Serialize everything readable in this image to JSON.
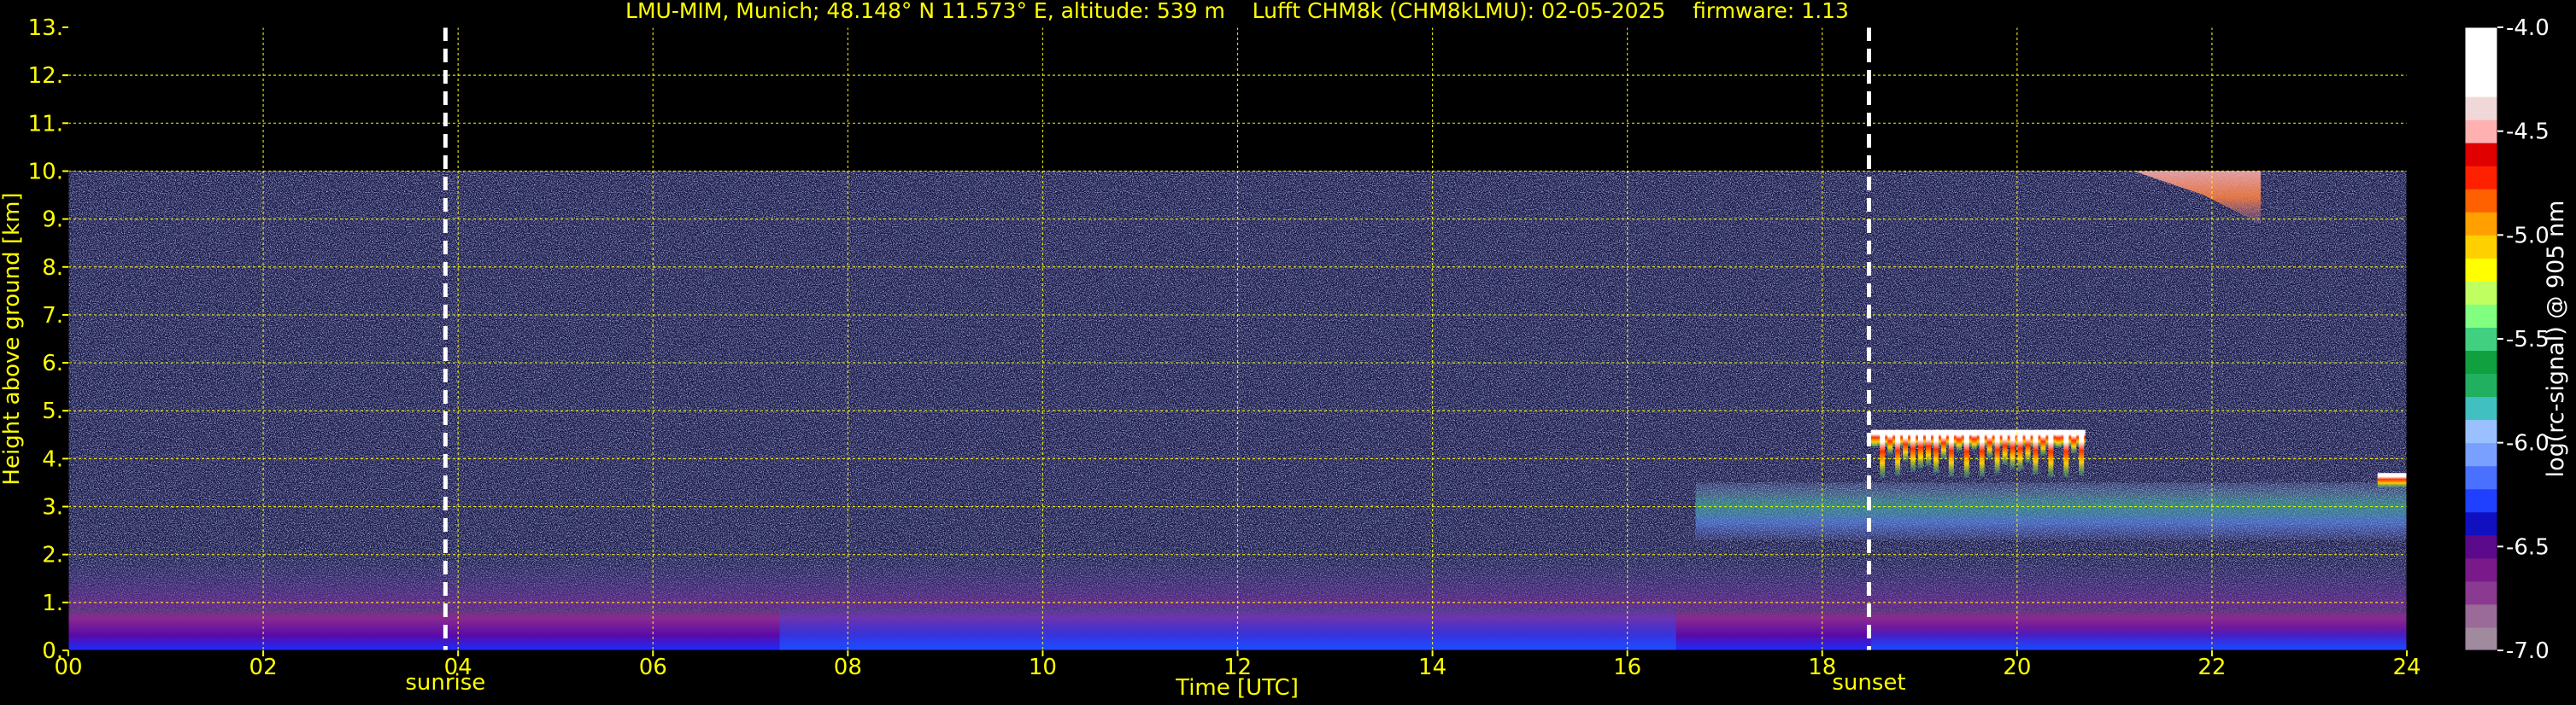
{
  "chart_data": {
    "type": "heatmap",
    "title": "LMU-MIM, Munich; 48.148° N 11.573° E, altitude: 539 m    Lufft CHM8k (CHM8kLMU): 02-05-2025    firmware: 1.13",
    "xlabel": "Time [UTC]",
    "ylabel": "Height above ground [km]",
    "xlim": [
      0,
      24
    ],
    "ylim": [
      0,
      13
    ],
    "x_ticks": [
      0,
      2,
      4,
      6,
      8,
      10,
      12,
      14,
      16,
      18,
      20,
      22,
      24
    ],
    "x_tick_labels": [
      "00",
      "02",
      "04",
      "06",
      "08",
      "10",
      "12",
      "14",
      "16",
      "18",
      "20",
      "22",
      "24"
    ],
    "y_ticks": [
      0,
      1,
      2,
      3,
      4,
      5,
      6,
      7,
      8,
      9,
      10,
      11,
      12,
      13
    ],
    "y_tick_labels": [
      "0.",
      "1.",
      "2.",
      "3.",
      "4.",
      "5.",
      "6.",
      "7.",
      "8.",
      "9.",
      "10.",
      "11.",
      "12.",
      "13."
    ],
    "grid": true,
    "grid_color": "#ffff00",
    "measurement_top_km": 10,
    "sun_events": [
      {
        "name": "sunrise",
        "time": 3.87
      },
      {
        "name": "sunset",
        "time": 18.48
      }
    ],
    "features": [
      {
        "kind": "boundary-layer",
        "t_start": 0,
        "t_end": 24,
        "h_bottom": 0,
        "h_top": 0.9
      },
      {
        "kind": "residual-layer",
        "t_start": 0,
        "t_end": 24,
        "h_bottom": 0.9,
        "h_top": 2.0
      },
      {
        "kind": "aerosol-layer",
        "t_start": 16.7,
        "t_end": 24,
        "h_bottom": 2.3,
        "h_top": 3.5
      },
      {
        "kind": "cloud-layer",
        "t_start": 18.5,
        "t_end": 20.7,
        "h_bottom": 3.6,
        "h_top": 4.6
      },
      {
        "kind": "cirrus",
        "t_start": 21.2,
        "t_end": 22.5,
        "h_bottom": 8.9,
        "h_top": 10.0
      },
      {
        "kind": "cloud-fragment",
        "t_start": 23.7,
        "t_end": 24,
        "h_bottom": 3.4,
        "h_top": 3.7
      }
    ],
    "colorbar": {
      "label": "log(rc-signal) @ 905 nm",
      "range": [
        -7.0,
        -4.0
      ],
      "ticks": [
        -7.0,
        -6.5,
        -6.0,
        -5.5,
        -5.0,
        -4.5,
        -4.0
      ],
      "tick_labels": [
        "-7.0",
        "-6.5",
        "-6.0",
        "-5.5",
        "-5.0",
        "-4.5",
        "-4.0"
      ],
      "colors": [
        "#a08a9e",
        "#9a6a98",
        "#8a3a90",
        "#7a1a8a",
        "#5a0a8a",
        "#1010c0",
        "#2040ff",
        "#4a70ff",
        "#7aa0ff",
        "#9ac0ff",
        "#40c0c0",
        "#20b060",
        "#10a040",
        "#40d080",
        "#80ff80",
        "#c0ff60",
        "#ffff00",
        "#ffd000",
        "#ffa000",
        "#ff6000",
        "#ff2000",
        "#e00000",
        "#ffb0b0",
        "#f0d8d8",
        "#ffffff",
        "#ffffff",
        "#ffffff"
      ]
    }
  }
}
